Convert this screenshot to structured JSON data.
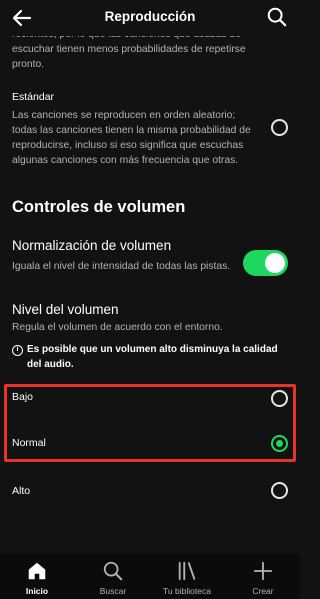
{
  "header": {
    "title": "Reproducción",
    "back_icon": "arrow-left-icon",
    "search_icon": "search-icon"
  },
  "shuffle_options": {
    "prev_desc_tail": "recientes, por lo que las canciones que acabas de escuchar tienen menos probabilidades de repetirse pronto.",
    "standard": {
      "label": "Estándar",
      "desc": "Las canciones se reproducen en orden aleatorio; todas las canciones tienen la misma probabilidad de reproducirse, incluso si eso significa que escuchas algunas canciones con más frecuencia que otras.",
      "selected": false
    }
  },
  "volume": {
    "section_title": "Controles de volumen",
    "normalization": {
      "title": "Normalización de volumen",
      "desc": "Iguala el nivel de intensidad de todas las pistas.",
      "enabled": true
    },
    "level": {
      "title": "Nivel del volumen",
      "desc": "Regula el volumen de acuerdo con el entorno.",
      "warning": "Es posible que un volumen alto disminuya la calidad del audio.",
      "options": [
        {
          "label": "Bajo",
          "selected": false
        },
        {
          "label": "Normal",
          "selected": true
        },
        {
          "label": "Alto",
          "selected": false
        }
      ]
    }
  },
  "colors": {
    "accent": "#1ed760",
    "highlight_box": "#e8332a",
    "background": "#121212"
  },
  "bottom_nav": [
    {
      "label": "Inicio",
      "icon": "home-icon",
      "active": true
    },
    {
      "label": "Buscar",
      "icon": "search-icon",
      "active": false
    },
    {
      "label": "Tu biblioteca",
      "icon": "library-icon",
      "active": false
    },
    {
      "label": "Crear",
      "icon": "plus-icon",
      "active": false
    }
  ]
}
